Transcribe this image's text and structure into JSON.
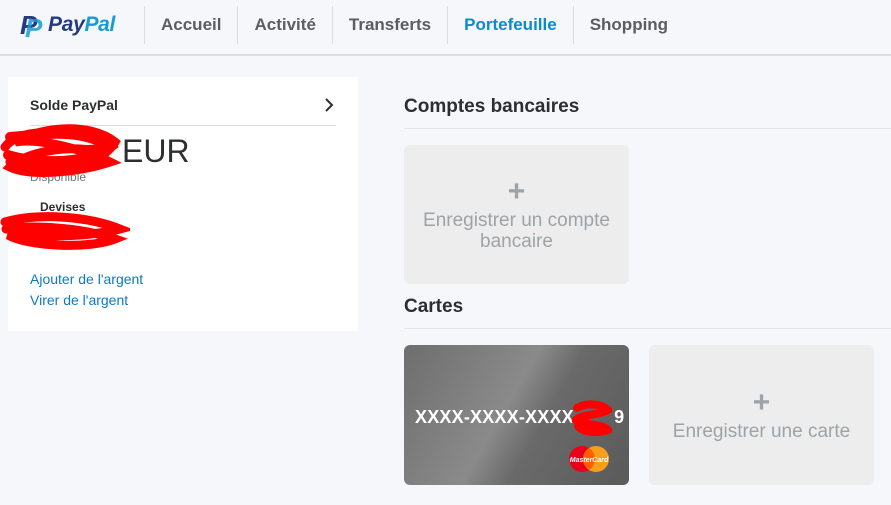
{
  "brand": {
    "pay": "Pay",
    "pal": "Pal",
    "logo_icon": "paypal-p-logo"
  },
  "nav": {
    "items": [
      {
        "label": "Accueil",
        "active": false
      },
      {
        "label": "Activité",
        "active": false
      },
      {
        "label": "Transferts",
        "active": false
      },
      {
        "label": "Portefeuille",
        "active": true
      },
      {
        "label": "Shopping",
        "active": false
      }
    ]
  },
  "balance": {
    "title": "Solde PayPal",
    "currency": "EUR",
    "available_label": "Disponible",
    "currencies_label": "Devises",
    "add_money_link": "Ajouter de l'argent",
    "withdraw_link": "Virer de l'argent"
  },
  "bank_accounts": {
    "title": "Comptes bancaires",
    "add_tile": {
      "plus": "+",
      "label": "Enregistrer un compte bancaire"
    }
  },
  "cards": {
    "title": "Cartes",
    "card": {
      "number_masked": "XXXX-XXXX-XXXX-",
      "last_digit": "9",
      "brand": "MasterCard"
    },
    "add_tile": {
      "plus": "+",
      "label": "Enregistrer une carte"
    }
  },
  "colors": {
    "active_nav": "#0c8acb",
    "link": "#0c7ac0",
    "redaction": "#ff0000",
    "paypal_dark_blue": "#253b80",
    "paypal_light_blue": "#179bd7"
  }
}
